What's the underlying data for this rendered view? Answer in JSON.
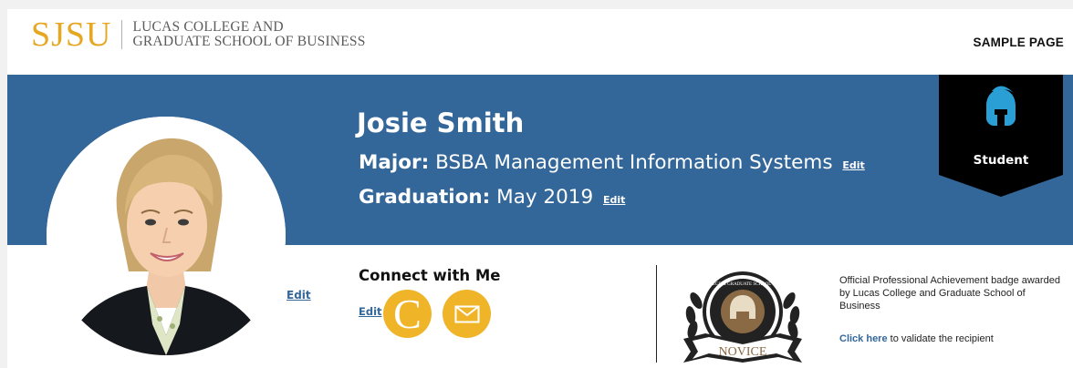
{
  "header": {
    "logo_mark": "SJSU",
    "logo_line1": "LUCAS COLLEGE AND",
    "logo_line2": "GRADUATE SCHOOL OF BUSINESS",
    "sample_label": "SAMPLE PAGE"
  },
  "profile": {
    "name": "Josie Smith",
    "major_label": "Major:",
    "major_value": "BSBA Management Information Systems",
    "graduation_label": "Graduation:",
    "graduation_value": "May 2019",
    "edit_label": "Edit",
    "photo_edit": "Edit"
  },
  "student_badge": {
    "label": "Student",
    "icon": "spartan-helmet-icon"
  },
  "connect": {
    "title": "Connect with Me",
    "edit_label": "Edit",
    "c_letter": "C",
    "mail_icon": "mail-icon"
  },
  "achievement": {
    "seal_top_text": "LUCAS COLLEGE & GRADUATE SCHOOL OF BUSINESS",
    "seal_level": "NOVICE",
    "description": "Official Professional Achievement badge awarded by Lucas College and Graduate School of Business",
    "link_label": "Click here",
    "link_suffix": " to validate the recipient"
  },
  "colors": {
    "brand_gold": "#e5a823",
    "banner_blue": "#336699",
    "button_gold": "#f0b429"
  }
}
